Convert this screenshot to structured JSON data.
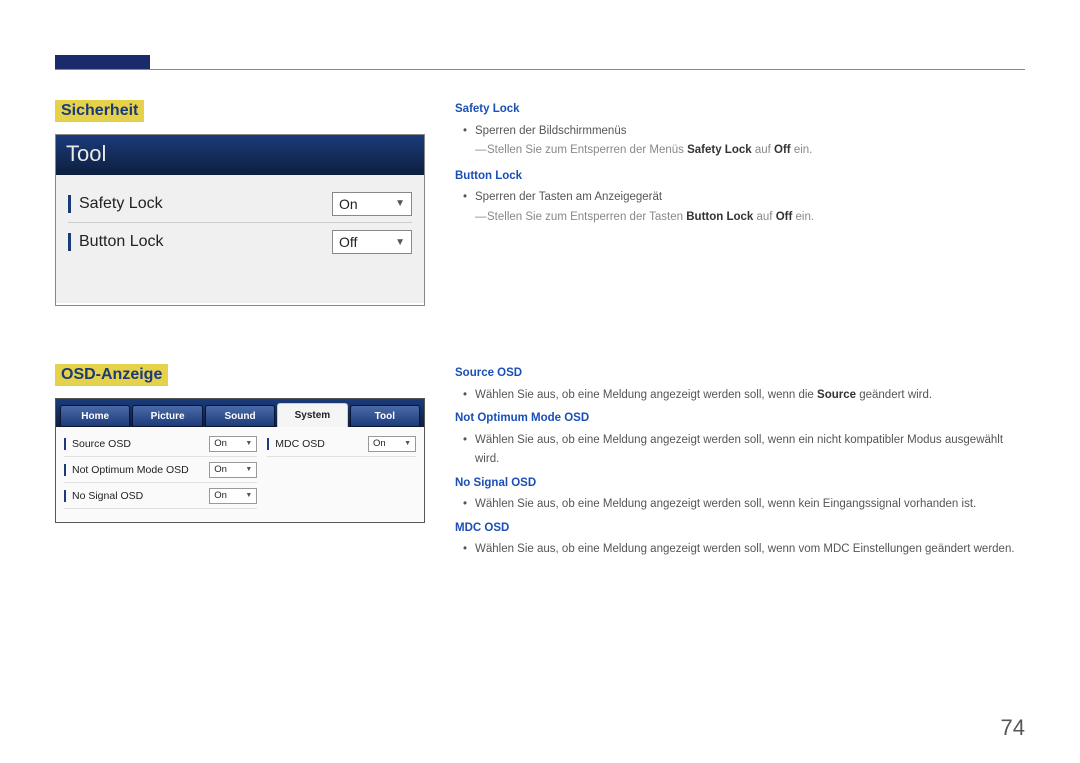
{
  "page_number": "74",
  "section1": {
    "title": "Sicherheit",
    "screenshot": {
      "header": "Tool",
      "rows": [
        {
          "label": "Safety Lock",
          "value": "On"
        },
        {
          "label": "Button Lock",
          "value": "Off"
        }
      ]
    },
    "items": [
      {
        "heading": "Safety Lock",
        "bullet": "Sperren der Bildschirmmenüs",
        "note_pre": "Stellen Sie zum Entsperren der Menüs ",
        "note_b1": "Safety Lock",
        "note_mid": " auf ",
        "note_b2": "Off",
        "note_post": " ein."
      },
      {
        "heading": "Button Lock",
        "bullet": "Sperren der Tasten am Anzeigegerät",
        "note_pre": "Stellen Sie zum Entsperren der Tasten ",
        "note_b1": "Button Lock",
        "note_mid": " auf ",
        "note_b2": "Off",
        "note_post": " ein."
      }
    ]
  },
  "section2": {
    "title": "OSD-Anzeige",
    "screenshot": {
      "tabs": [
        "Home",
        "Picture",
        "Sound",
        "System",
        "Tool"
      ],
      "active_tab_index": 3,
      "col1": [
        {
          "label": "Source OSD",
          "value": "On"
        },
        {
          "label": "Not Optimum Mode OSD",
          "value": "On"
        },
        {
          "label": "No Signal OSD",
          "value": "On"
        }
      ],
      "col2": [
        {
          "label": "MDC OSD",
          "value": "On"
        }
      ]
    },
    "items": [
      {
        "heading": "Source OSD",
        "bullet_pre": "Wählen Sie aus, ob eine Meldung angezeigt werden soll, wenn die ",
        "bullet_b": "Source",
        "bullet_post": " geändert wird."
      },
      {
        "heading": "Not Optimum Mode OSD",
        "bullet_pre": "Wählen Sie aus, ob eine Meldung angezeigt werden soll, wenn ein nicht kompatibler Modus ausgewählt wird.",
        "bullet_b": "",
        "bullet_post": ""
      },
      {
        "heading": "No Signal OSD",
        "bullet_pre": "Wählen Sie aus, ob eine Meldung angezeigt werden soll, wenn kein Eingangssignal vorhanden ist.",
        "bullet_b": "",
        "bullet_post": ""
      },
      {
        "heading": "MDC OSD",
        "bullet_pre": "Wählen Sie aus, ob eine Meldung angezeigt werden soll, wenn vom MDC Einstellungen geändert werden.",
        "bullet_b": "",
        "bullet_post": ""
      }
    ]
  }
}
